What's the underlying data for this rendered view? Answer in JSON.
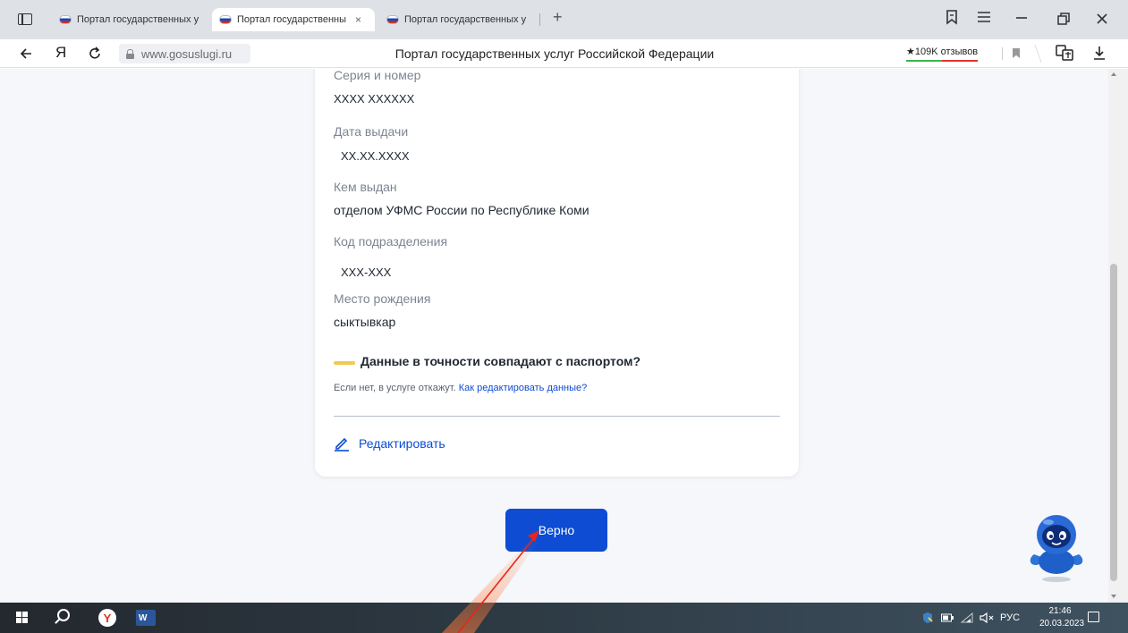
{
  "browser": {
    "tabs": [
      {
        "title": "Портал государственных у",
        "active": false
      },
      {
        "title": "Портал государственны",
        "active": true,
        "close": "×"
      },
      {
        "title": "Портал государственных у",
        "active": false
      }
    ],
    "new_tab": "+",
    "url": "www.gosuslugi.ru",
    "page_title": "Портал государственных услуг Российской Федерации",
    "reviews": "★109K отзывов",
    "yandex_letter": "Я"
  },
  "form": {
    "fields": [
      {
        "label": "Серия и номер",
        "value": "XXXX XXXXXX"
      },
      {
        "label": "Дата выдачи",
        "value": "XX.XX.XXXX"
      },
      {
        "label": "Кем выдан",
        "value": "отделом УФМС России по Республике Коми"
      },
      {
        "label": "Код подразделения",
        "value": "XXX-XXX"
      },
      {
        "label": "Место рождения",
        "value": "сыктывкар"
      }
    ],
    "warning": "Данные в точности совпадают с паспортом?",
    "hint_prefix": "Если нет, в услуге откажут.",
    "hint_link": "Как редактировать данные?",
    "edit_label": "Редактировать",
    "confirm_label": "Верно"
  },
  "taskbar": {
    "yandex_icon": "Y",
    "word_icon": "W",
    "language": "РУС",
    "time": "21:46",
    "date": "20.03.2023"
  },
  "colors": {
    "accent": "#0d4cd3",
    "warning": "#f2c94c",
    "annotation_arrow": "#e8251a"
  }
}
